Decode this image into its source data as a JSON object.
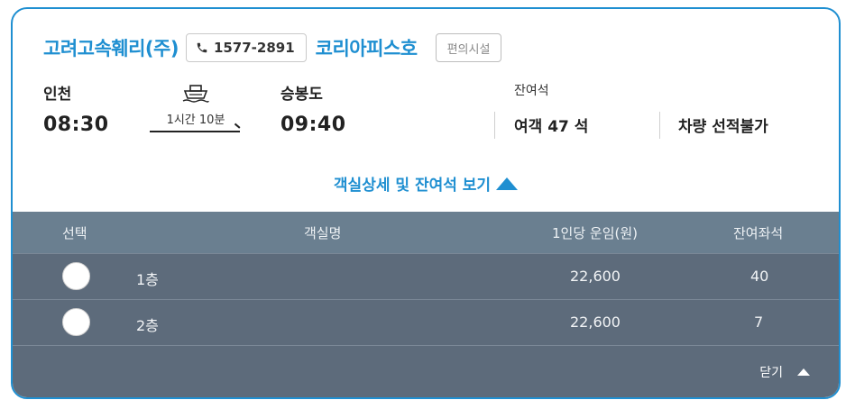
{
  "header": {
    "company": "고려고속훼리(주)",
    "phone": "1577-2891",
    "ship_name": "코리아피스호",
    "facility_button": "편의시설"
  },
  "route": {
    "departure_port": "인천",
    "departure_time": "08:30",
    "duration": "1시간 10분",
    "arrival_port": "승봉도",
    "arrival_time": "09:40"
  },
  "seats": {
    "label": "잔여석",
    "passenger": "여객 47 석",
    "vehicle": "차량 선적불가"
  },
  "detail_toggle": "객실상세 및 잔여석 보기",
  "table": {
    "headers": [
      "선택",
      "객실명",
      "1인당 운임(원)",
      "잔여좌석"
    ],
    "rows": [
      {
        "name": "1층",
        "fare": "22,600",
        "remaining": "40"
      },
      {
        "name": "2층",
        "fare": "22,600",
        "remaining": "7"
      }
    ],
    "close_label": "닫기"
  },
  "colors": {
    "accent": "#1f8fd1",
    "table_header": "#6a7f90",
    "table_body": "#5d6b7b"
  }
}
